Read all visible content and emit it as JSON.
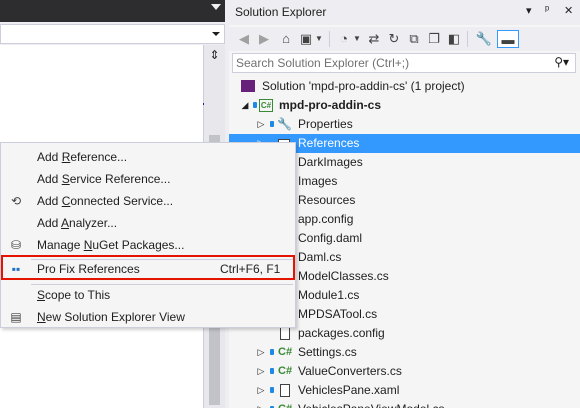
{
  "solution_explorer": {
    "title": "Solution Explorer",
    "title_controls": [
      "▾",
      "ᵖ",
      "✕"
    ],
    "search_placeholder": "Search Solution Explorer (Ctrl+;)",
    "tree": [
      {
        "label": "Solution 'mpd-pro-addin-cs' (1 project)",
        "icon": "solution-icon",
        "indent": 0
      },
      {
        "label": "mpd-pro-addin-cs",
        "icon": "csharp-project-icon",
        "indent": 1,
        "bold": true,
        "expanded": true
      },
      {
        "label": "Properties",
        "icon": "wrench-icon",
        "indent": 2
      },
      {
        "label": "References",
        "icon": "references-icon",
        "indent": 2,
        "selected": true
      },
      {
        "label": "DarkImages",
        "icon": "folder-icon",
        "indent": 2
      },
      {
        "label": "Images",
        "icon": "folder-icon",
        "indent": 2
      },
      {
        "label": "Resources",
        "icon": "folder-icon",
        "indent": 2
      },
      {
        "label": "app.config",
        "icon": "file-icon",
        "indent": 2
      },
      {
        "label": "Config.daml",
        "icon": "file-icon",
        "indent": 2
      },
      {
        "label": "Daml.cs",
        "icon": "csharp-file-icon",
        "indent": 2
      },
      {
        "label": "ModelClasses.cs",
        "icon": "csharp-file-icon",
        "indent": 2
      },
      {
        "label": "Module1.cs",
        "icon": "csharp-file-icon",
        "indent": 2
      },
      {
        "label": "MPDSATool.cs",
        "icon": "csharp-file-icon",
        "indent": 2
      },
      {
        "label": "packages.config",
        "icon": "file-icon",
        "indent": 2
      },
      {
        "label": "Settings.cs",
        "icon": "csharp-file-icon",
        "indent": 2
      },
      {
        "label": "ValueConverters.cs",
        "icon": "csharp-file-icon",
        "indent": 2
      },
      {
        "label": "VehiclesPane.xaml",
        "icon": "xaml-file-icon",
        "indent": 2
      },
      {
        "label": "VehiclesPaneViewModel.cs",
        "icon": "csharp-file-icon",
        "indent": 2
      }
    ]
  },
  "context_menu": {
    "items": [
      {
        "label": "Add Reference...",
        "underline_index": 4,
        "icon": "",
        "shortcut": ""
      },
      {
        "label": "Add Service Reference...",
        "underline_index": 4,
        "icon": "",
        "shortcut": ""
      },
      {
        "label": "Add Connected Service...",
        "underline_index": 4,
        "icon": "connected-service-icon",
        "shortcut": ""
      },
      {
        "label": "Add Analyzer...",
        "underline_index": 4,
        "icon": "",
        "shortcut": ""
      },
      {
        "label": "Manage NuGet Packages...",
        "underline_index": 7,
        "icon": "nuget-icon",
        "shortcut": ""
      },
      {
        "label": "Pro Fix References",
        "underline_index": -1,
        "icon": "pro-fix-references-icon",
        "shortcut": "Ctrl+F6, F1",
        "highlighted": true
      },
      {
        "label": "Scope to This",
        "underline_index": 0,
        "icon": "",
        "shortcut": ""
      },
      {
        "label": "New Solution Explorer View",
        "underline_index": 0,
        "icon": "new-view-icon",
        "shortcut": ""
      }
    ]
  },
  "colors": {
    "selection": "#3399FF",
    "highlight_box": "#E51400",
    "csharp_green": "#388A34",
    "dark_titlebar": "#2D2D30"
  }
}
